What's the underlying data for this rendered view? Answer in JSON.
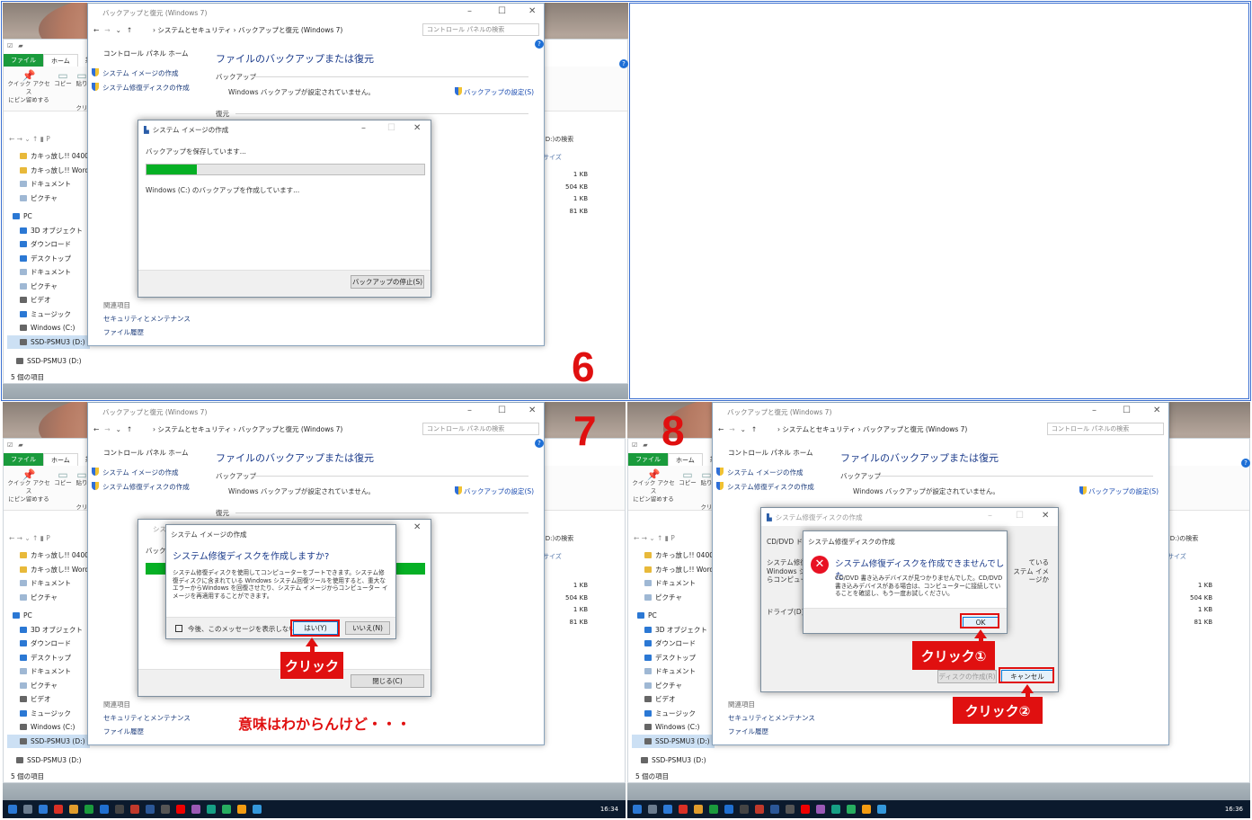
{
  "window_title": "バックアップと復元 (Windows 7)",
  "breadcrumb": "› システムとセキュリティ › バックアップと復元 (Windows 7)",
  "search_placeholder": "コントロール パネルの検索",
  "sidebar": {
    "home": "コントロール パネル ホーム",
    "image": "システム イメージの作成",
    "disc": "システム修復ディスクの作成",
    "related": "関連項目",
    "security": "セキュリティとメンテナンス",
    "history": "ファイル履歴"
  },
  "main": {
    "heading": "ファイルのバックアップまたは復元",
    "backup_label": "バックアップ",
    "backup_status": "Windows バックアップが設定されていません。",
    "settings_link": "バックアップの設定(S)",
    "restore_label": "復元"
  },
  "explorer": {
    "ribbon_file": "ファイル",
    "ribbon_home": "ホーム",
    "ribbon_share": "共有",
    "quick_access": "クイック アクセス",
    "pin": "にピン留めする",
    "copy": "コピー",
    "paste": "貼り",
    "clip": "クリ",
    "path_pc": "P",
    "search_d": "(D:)の検索",
    "col_size": "サイズ",
    "nav": [
      "カキっ放し!! 0400～0",
      "カキっ放し!! Word フ",
      "ドキュメント",
      "ピクチャ",
      "PC",
      "3D オブジェクト",
      "ダウンロード",
      "デスクトップ",
      "ドキュメント",
      "ピクチャ",
      "ビデオ",
      "ミュージック",
      "Windows (C:)",
      "SSD-PSMU3 (D:)"
    ],
    "drive2": "SSD-PSMU3 (D:)",
    "status": "5 個の項目",
    "sizes": [
      "1 KB",
      "504 KB",
      "1 KB",
      "81 KB"
    ]
  },
  "p6": {
    "num": "6",
    "dlg_title": "システム イメージの作成",
    "saving": "バックアップを保存しています...",
    "progress": 0.18,
    "creating": "Windows (C:) のバックアップを作成しています...",
    "stop": "バックアップの停止(S)"
  },
  "p7": {
    "num": "7",
    "behind_title": "シス",
    "behind_label": "バック",
    "q_title": "システム イメージの作成",
    "q_heading": "システム修復ディスクを作成しますか?",
    "q_body": "システム修復ディスクを使用してコンピューターをブートできます。システム修復ディスクに含まれている Windows システム回復ツールを使用すると、重大なエラーからWindows を回復させたり、システム イメージからコンピューター イメージを再適用することができます。",
    "dont_show": "今後、このメッセージを表示しない",
    "yes": "はい(Y)",
    "no": "いいえ(N)",
    "close": "閉じる(C)",
    "callout": "クリック",
    "note": "意味はわからんけど・・・"
  },
  "p8": {
    "num": "8",
    "behind_title": "システム修復ディスクの作成",
    "cd_label": "CD/DVD ドラ",
    "left_text1": "システム修復",
    "left_text2": "Windows シ",
    "left_text3": "らコンピュータ",
    "right_text1": "ている",
    "right_text2": "ステム イメージか",
    "drive": "ドライブ(D):",
    "err_title": "システム修復ディスクの作成",
    "err_heading": "システム修復ディスクを作成できませんでした",
    "err_body": "CD/DVD 書き込みデバイスが見つかりませんでした。CD/DVD 書き込みデバイスがある場合は、コンピューターに接続していることを確認し、もう一度お試しください。",
    "ok": "OK",
    "create": "ディスクの作成(R)",
    "cancel": "キャンセル",
    "callout1": "クリック①",
    "callout2": "クリック②"
  },
  "taskbar": {
    "clock": "16:34",
    "clock2": "16:36"
  }
}
